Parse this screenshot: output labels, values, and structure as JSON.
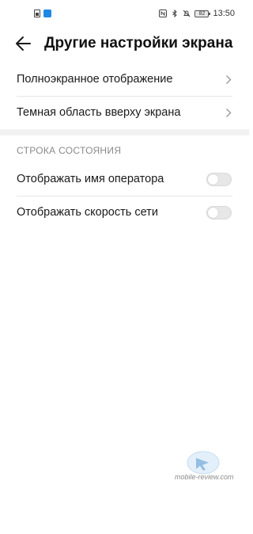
{
  "status_bar": {
    "time": "13:50",
    "battery": "82",
    "notification_icons": [
      "sim-card-icon",
      "app-notification-icon"
    ],
    "system_icons": [
      "nfc-icon",
      "bluetooth-icon",
      "mute-bell-icon",
      "battery-icon"
    ]
  },
  "header": {
    "back_icon": "arrow-left-icon",
    "title": "Другие настройки экрана"
  },
  "items": [
    {
      "label": "Полноэкранное отображение",
      "icon": "chevron-right-icon"
    },
    {
      "label": "Темная область вверху экрана",
      "icon": "chevron-right-icon"
    }
  ],
  "status_section": {
    "title": "СТРОКА СОСТОЯНИЯ",
    "toggles": [
      {
        "label": "Отображать имя оператора",
        "on": false
      },
      {
        "label": "Отображать скорость сети",
        "on": false
      }
    ]
  },
  "watermark": {
    "text": "mobile-review.com"
  },
  "colors": {
    "accent": "#1e88e5",
    "section_title": "#8a8a8a",
    "toggle_off": "#e7e7e7",
    "divider": "#e6e6e6"
  }
}
